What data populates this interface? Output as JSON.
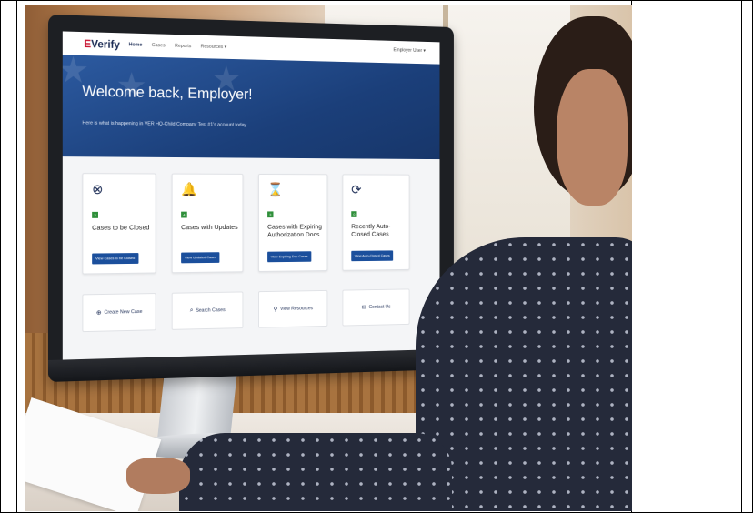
{
  "nav": {
    "logo_e": "E",
    "logo_rest": "Verify",
    "items": [
      {
        "label": "Home"
      },
      {
        "label": "Cases"
      },
      {
        "label": "Reports"
      },
      {
        "label": "Resources ▾"
      }
    ],
    "user": "Employer User ▾"
  },
  "hero": {
    "title": "Welcome back, Employer!",
    "subtitle": "Here is what is happening in VER HQ-Child Company Test #1's account today"
  },
  "cards": [
    {
      "icon": "circle-x-icon",
      "glyph": "⊗",
      "count": "3",
      "title": "Cases to be Closed",
      "button": "View Cases to be Closed"
    },
    {
      "icon": "bell-icon",
      "glyph": "🔔",
      "count": "4",
      "title": "Cases with Updates",
      "button": "View Updated Cases"
    },
    {
      "icon": "hourglass-icon",
      "glyph": "⌛",
      "count": "3",
      "title": "Cases with Expiring Authorization Docs",
      "button": "View Expiring Doc Cases"
    },
    {
      "icon": "refresh-icon",
      "glyph": "⟳",
      "count": "0",
      "title": "Recently Auto-Closed Cases",
      "button": "View Auto-Closed Cases"
    }
  ],
  "actions": [
    {
      "icon": "plus-circle-icon",
      "glyph": "⊕",
      "label": "Create New Case"
    },
    {
      "icon": "search-icon",
      "glyph": "⌕",
      "label": "Search Cases"
    },
    {
      "icon": "pin-icon",
      "glyph": "⚲",
      "label": "View Resources"
    },
    {
      "icon": "mail-icon",
      "glyph": "✉",
      "label": "Contact Us"
    }
  ],
  "colors": {
    "brand_navy": "#1c2c55",
    "brand_red": "#c8102e",
    "hero_blue": "#1b3f7a",
    "button_blue": "#1b4f9c",
    "badge_green": "#2f8f3a"
  }
}
